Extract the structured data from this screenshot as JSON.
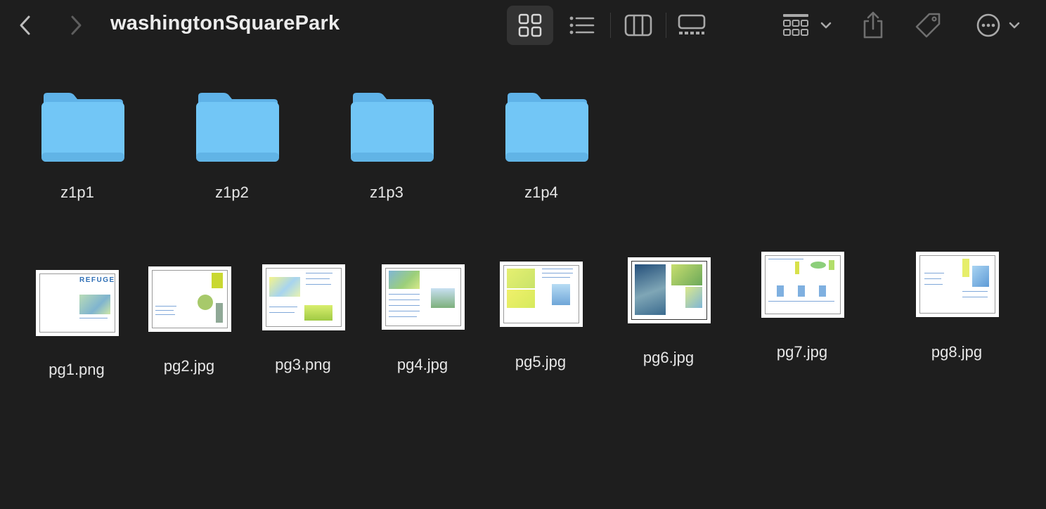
{
  "window": {
    "title": "washingtonSquarePark"
  },
  "toolbar": {
    "icons": [
      "back-icon",
      "forward-icon",
      "icon-view-icon",
      "list-view-icon",
      "column-view-icon",
      "gallery-view-icon",
      "group-icon",
      "share-icon",
      "tag-icon",
      "more-icon"
    ]
  },
  "folders": [
    {
      "name": "z1p1"
    },
    {
      "name": "z1p2"
    },
    {
      "name": "z1p3"
    },
    {
      "name": "z1p4"
    }
  ],
  "files": [
    {
      "name": "pg1.png",
      "thumb_title": "REFUGE"
    },
    {
      "name": "pg2.jpg"
    },
    {
      "name": "pg3.png"
    },
    {
      "name": "pg4.jpg"
    },
    {
      "name": "pg5.jpg"
    },
    {
      "name": "pg6.jpg"
    },
    {
      "name": "pg7.jpg"
    },
    {
      "name": "pg8.jpg"
    }
  ],
  "colors": {
    "background": "#1e1e1e",
    "folder": "#6ec3f4",
    "text": "#e6e6e6",
    "icon": "#8d8d8d"
  }
}
